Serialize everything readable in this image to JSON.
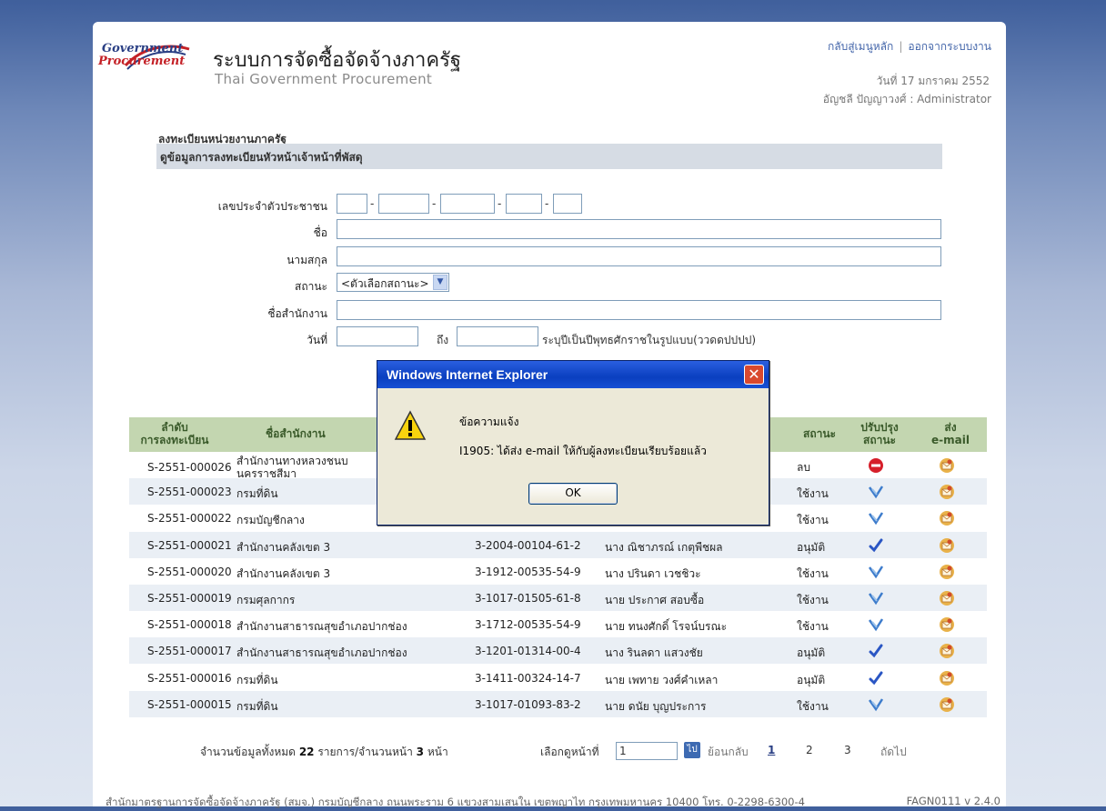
{
  "header": {
    "logo_line1": "Government",
    "logo_line2": "Procurement",
    "title_th": "ระบบการจัดซื้อจัดจ้างภาครัฐ",
    "title_en": "Thai Government Procurement",
    "link_home": "กลับสู่เมนูหลัก",
    "link_logout": "ออกจากระบบงาน",
    "separator": "|",
    "date": "วันที่ 17 มกราคม 2552",
    "user": "อัญชลี ปัญญาวงศ์ : Administrator"
  },
  "section": {
    "title": "ลงทะเบียนหน่วยงานภาครัฐ",
    "subtitle": "ดูข้อมูลการลงทะเบียนหัวหน้าเจ้าหน้าที่พัสดุ"
  },
  "form": {
    "id_label": "เลขประจำตัวประชาชน",
    "name_label": "ชื่อ",
    "surname_label": "นามสกุล",
    "status_label": "สถานะ",
    "status_value": "<ตัวเลือกสถานะ>",
    "office_label": "ชื่อสำนักงาน",
    "date_label": "วันที่",
    "to_label": "ถึง",
    "date_hint": "ระบุปีเป็นปีพุทธศักราชในรูปแบบ(ววดดปปปป)"
  },
  "table": {
    "headers": {
      "seq": "ลำดับ\nการลงทะเบียน",
      "office": "ชื่อสำนักงาน",
      "status": "สถานะ",
      "update": "ปรับปรุง\nสถานะ",
      "email": "ส่ง\ne-mail"
    },
    "rows": [
      {
        "seq": "S-2551-000026",
        "office": "สำนักงานทางหลวงชนบ\nนครราชสีมา",
        "id": "",
        "name": "",
        "status": "ลบ",
        "icon": "delete-icon"
      },
      {
        "seq": "S-2551-000023",
        "office": "กรมที่ดิน",
        "id": "",
        "name": "",
        "status": "ใช้งาน",
        "icon": "edit-icon"
      },
      {
        "seq": "S-2551-000022",
        "office": "กรมบัญชีกลาง",
        "id": "",
        "name": "",
        "status": "ใช้งาน",
        "icon": "edit-icon"
      },
      {
        "seq": "S-2551-000021",
        "office": "สำนักงานคลังเขต 3",
        "id": "3-2004-00104-61-2",
        "name": "นาง ณิชาภรณ์ เกตุพืชผล",
        "status": "อนุมัติ",
        "icon": "check-icon"
      },
      {
        "seq": "S-2551-000020",
        "office": "สำนักงานคลังเขต 3",
        "id": "3-1912-00535-54-9",
        "name": "นาง ปรินดา เวชชิวะ",
        "status": "ใช้งาน",
        "icon": "edit-icon"
      },
      {
        "seq": "S-2551-000019",
        "office": "กรมศุลกากร",
        "id": "3-1017-01505-61-8",
        "name": "นาย ประกาศ สอบซื้อ",
        "status": "ใช้งาน",
        "icon": "edit-icon"
      },
      {
        "seq": "S-2551-000018",
        "office": "สำนักงานสาธารณสุขอำเภอปากช่อง",
        "id": "3-1712-00535-54-9",
        "name": "นาย ทนงศักดิ์ โรจน์บรณะ",
        "status": "ใช้งาน",
        "icon": "edit-icon"
      },
      {
        "seq": "S-2551-000017",
        "office": "สำนักงานสาธารณสุขอำเภอปากช่อง",
        "id": "3-1201-01314-00-4",
        "name": "นาง รินลดา แสวงชัย",
        "status": "อนุมัติ",
        "icon": "check-icon"
      },
      {
        "seq": "S-2551-000016",
        "office": "กรมที่ดิน",
        "id": "3-1411-00324-14-7",
        "name": "นาย เพทาย วงศ์คำเหลา",
        "status": "อนุมัติ",
        "icon": "check-icon"
      },
      {
        "seq": "S-2551-000015",
        "office": "กรมที่ดิน",
        "id": "3-1017-01093-83-2",
        "name": "นาย ดนัย บุญประการ",
        "status": "ใช้งาน",
        "icon": "edit-icon"
      }
    ]
  },
  "pager": {
    "summary_prefix": "จำนวนข้อมูลทั้งหมด",
    "total": "22",
    "summary_mid": "รายการ/จำนวนหน้า",
    "pages": "3",
    "summary_suffix": "หน้า",
    "goto_label": "เลือกดูหน้าที่",
    "goto_value": "1",
    "go_button": "ไป",
    "prev": "ย้อนกลับ",
    "page1": "1",
    "page2": "2",
    "page3": "3",
    "next": "ถัดไป"
  },
  "footer": {
    "address": "สำนักมาตรฐานการจัดซื้อจัดจ้างภาครัฐ (สมจ.) กรมบัญชีกลาง ถนนพระราม 6 แขวงสามเสนใน เขตพญาไท กรุงเทพมหานคร 10400 โทร. 0-2298-6300-4",
    "version": "FAGN0111 v 2.4.0"
  },
  "dialog": {
    "title": "Windows Internet Explorer",
    "close": "✕",
    "heading": "ข้อความแจ้ง",
    "message": "I1905: ได้ส่ง e-mail ให้กับผู้ลงทะเบียนเรียบร้อยแล้ว",
    "ok": "OK"
  },
  "colors": {
    "table_header": "#c3d6b0",
    "row_alt": "#eaeff5",
    "dialog_title": "#0a3fbf",
    "link": "#4466aa"
  }
}
